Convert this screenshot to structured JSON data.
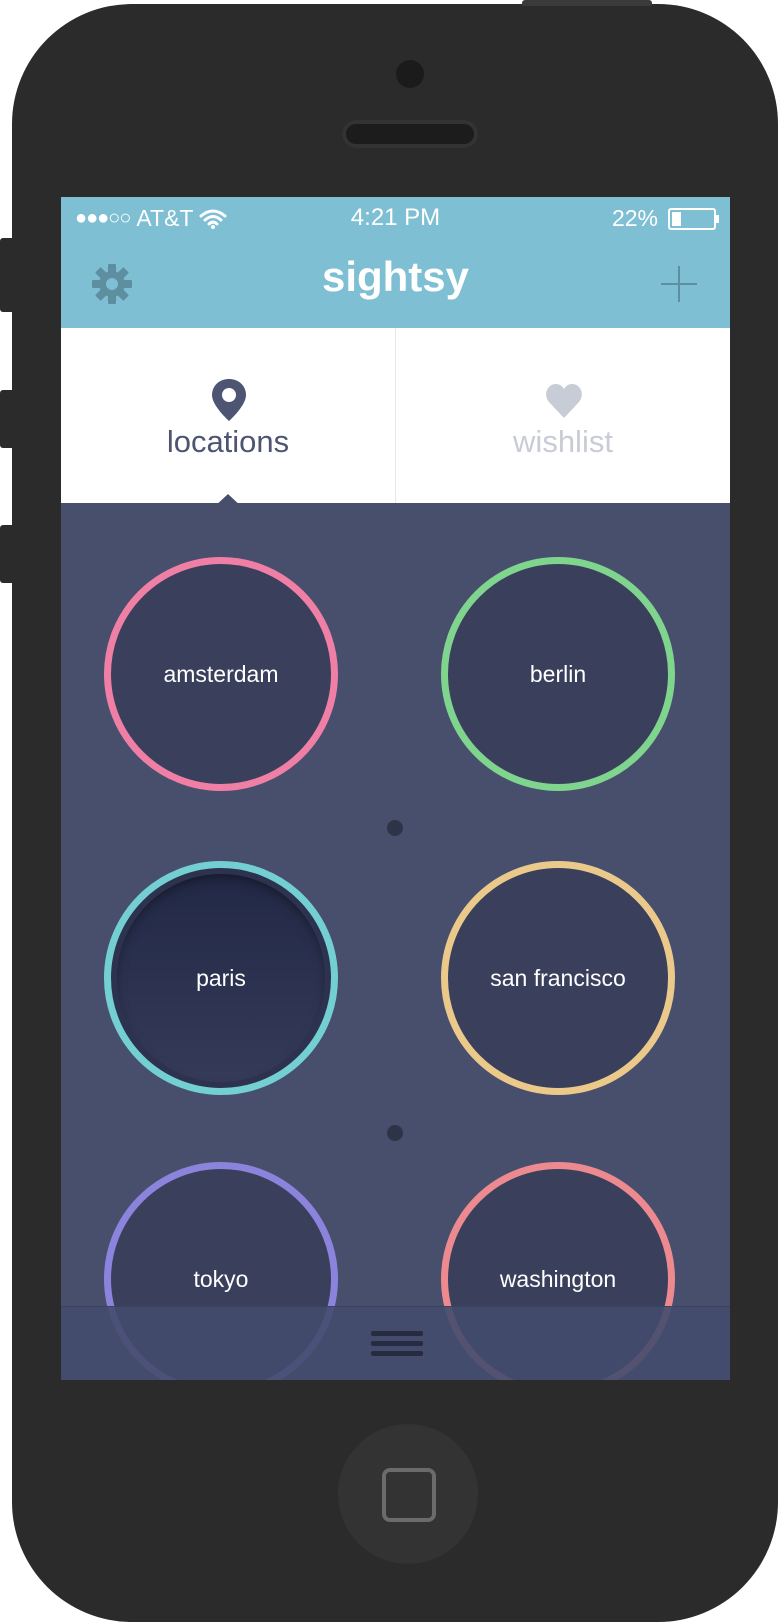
{
  "status_bar": {
    "signal": "●●●○○",
    "carrier": "AT&T",
    "wifi_icon": "wifi-icon",
    "time": "4:21 PM",
    "battery_percent": "22%",
    "battery_level": 0.22
  },
  "nav": {
    "title": "sightsy",
    "left_icon": "gear-icon",
    "right_icon": "plus-icon"
  },
  "tabs": [
    {
      "label": "locations",
      "icon": "location-pin-icon",
      "active": true
    },
    {
      "label": "wishlist",
      "icon": "heart-icon",
      "active": false
    }
  ],
  "cities": [
    {
      "name": "amsterdam",
      "color": "#f07fa6"
    },
    {
      "name": "berlin",
      "color": "#7fd48e"
    },
    {
      "name": "paris",
      "color": "#74cfd3"
    },
    {
      "name": "san francisco",
      "color": "#ebc98a"
    },
    {
      "name": "tokyo",
      "color": "#8c83dc"
    },
    {
      "name": "washington",
      "color": "#ec8a90"
    }
  ],
  "colors": {
    "header": "#7ebfd3",
    "background": "#474f6d",
    "circle_fill": "#3a405c"
  },
  "bottom_bar": {
    "icon": "menu-icon"
  }
}
